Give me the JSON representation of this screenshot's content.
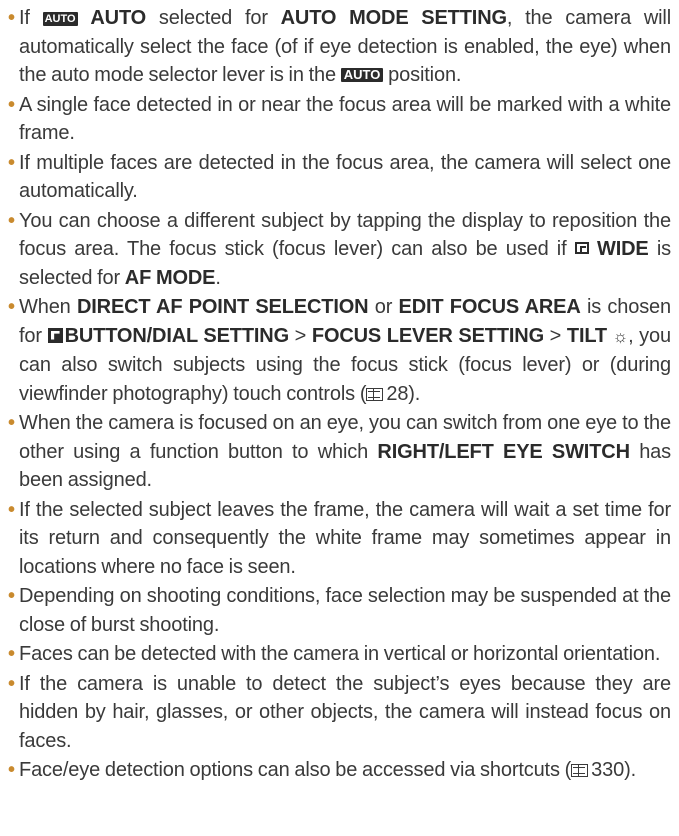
{
  "bullet_char": "•",
  "colors": {
    "bullet": "#c98a2e",
    "text": "#3a3a3a",
    "keyword": "#2b2b2b"
  },
  "icons": {
    "auto_chip": "AUTO",
    "auto_position": "AUTO",
    "wide_icon": "wide-af-mode-icon",
    "setup_icon": "setup-menu-icon",
    "tilt_symbol": "tilt-icon",
    "page_ref_icon": "page-reference-icon"
  },
  "notes": {
    "b1": {
      "t1": "If ",
      "k1": "AUTO",
      "t2": " selected for ",
      "k2": "AUTO MODE SETTING",
      "t3": ", the camera will automatically select the face (of if eye detection is enabled, the eye) when the auto mode selector lever is in the ",
      "k3": "AUTO",
      "t4": " position."
    },
    "b2": {
      "t1": "A single face detected in or near the focus area will be marked with a white frame."
    },
    "b3": {
      "t1": "If multiple faces are detected in the focus area, the camera will select one automatically."
    },
    "b4": {
      "t1": "You can choose a different subject by tapping the display to reposition the focus area. The focus stick (focus lever) can also be used if ",
      "k1": "WIDE",
      "t2": " is selected for ",
      "k2": "AF MODE",
      "t3": "."
    },
    "b5": {
      "t1": "When ",
      "k1": "DIRECT AF POINT SELECTION",
      "t2": " or ",
      "k2": "EDIT FOCUS AREA",
      "t3": " is chosen for ",
      "k3": "BUTTON/DIAL SETTING",
      "t4": " > ",
      "k4": "FOCUS LEVER SETTING",
      "t5": " > ",
      "k5": "TILT",
      "tilt_glyph": "☼",
      "t6": ", you can also switch subjects using the focus stick (focus lever) or (during viewfinder photography) touch controls (",
      "ref": "28",
      "t7": ")."
    },
    "b6": {
      "t1": "When the camera is focused on an eye, you can switch from one eye to the other using a function button to which ",
      "k1": "RIGHT/LEFT EYE SWITCH",
      "t2": " has been assigned."
    },
    "b7": {
      "t1": "If the selected subject leaves the frame, the camera will wait a set time for its return and consequently the white frame may sometimes appear in locations where no face is seen."
    },
    "b8": {
      "t1": "Depending on shooting conditions, face selection may be suspended at the close of burst shooting."
    },
    "b9": {
      "t1": "Faces can be detected with the camera in vertical or horizontal orientation."
    },
    "b10": {
      "t1": "If the camera is unable to detect the subject’s eyes because they are hidden by hair, glasses, or other objects, the camera will instead focus on faces."
    },
    "b11": {
      "t1": "Face/eye detection options can also be accessed via shortcuts (",
      "ref": "330",
      "t2": ")."
    }
  }
}
